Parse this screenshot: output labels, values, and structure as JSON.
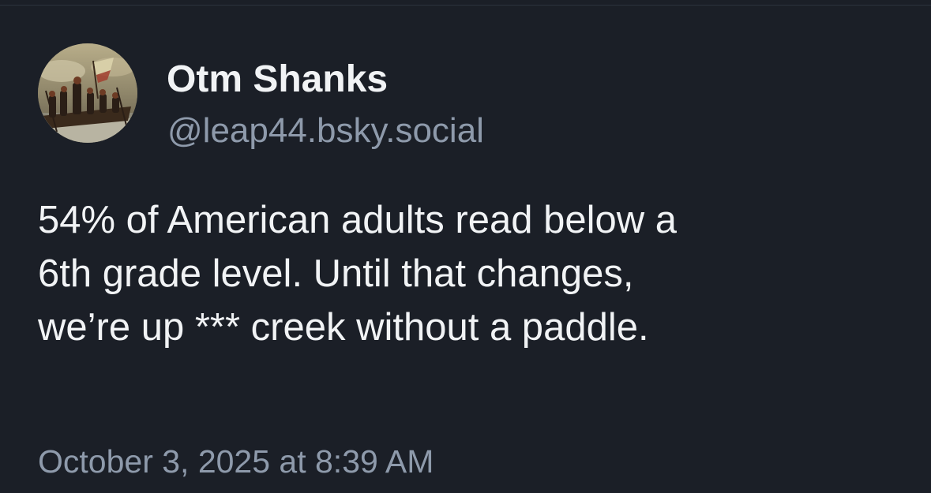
{
  "post": {
    "author": {
      "display_name": "Otm Shanks",
      "handle": "@leap44.bsky.social",
      "avatar_icon": "washington-crossing-delaware-painting"
    },
    "text_lines": [
      "54% of American adults read below a",
      "6th grade level. Until that changes,",
      "we’re up *** creek without a paddle."
    ],
    "timestamp": "October 3, 2025 at 8:39 AM"
  },
  "colors": {
    "background": "#1b1f27",
    "text_primary": "#f1f3f5",
    "text_secondary": "#8e9aab"
  }
}
